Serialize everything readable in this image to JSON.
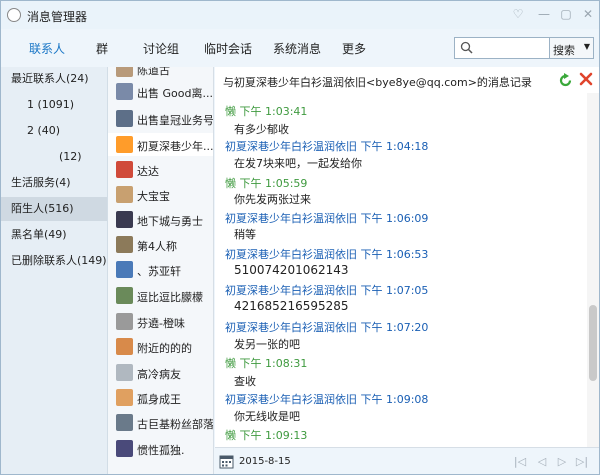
{
  "window": {
    "title": "消息管理器"
  },
  "nav": {
    "tabs": [
      "联系人",
      "群",
      "讨论组",
      "临时会话",
      "系统消息",
      "更多"
    ],
    "search_placeholder": "",
    "search_button": "搜索"
  },
  "left_panel": {
    "items": [
      {
        "label": "最近联系人(24)"
      },
      {
        "label": "1       (1091)"
      },
      {
        "label": "2         (40)"
      },
      {
        "label": "(12)"
      },
      {
        "label": "生活服务(4)"
      },
      {
        "label": "陌生人(516)"
      },
      {
        "label": "黑名单(49)"
      },
      {
        "label": "已删除联系人(149)"
      }
    ]
  },
  "contacts": [
    {
      "name": "陈道古",
      "color": "#b89a7a"
    },
    {
      "name": "出售  Good离...",
      "color": "#7a8aa8"
    },
    {
      "name": "出售皇冠业务号",
      "color": "#5d6f88"
    },
    {
      "name": "初夏深巷少年...",
      "color": "#ff9c2a"
    },
    {
      "name": "达达",
      "color": "#d04a3a"
    },
    {
      "name": "大宝宝",
      "color": "#c8a070"
    },
    {
      "name": "地下城与勇士",
      "color": "#3a3a50"
    },
    {
      "name": "第4人称",
      "color": "#8c7a5a"
    },
    {
      "name": "、苏亚轩",
      "color": "#4a7ab8"
    },
    {
      "name": "逗比逗比朦檬",
      "color": "#6a8a5a"
    },
    {
      "name": "芬遶-橙味",
      "color": "#9a9a9a"
    },
    {
      "name": "附近的的的",
      "color": "#d88a4a"
    },
    {
      "name": "高冷病友",
      "color": "#b0b8c0"
    },
    {
      "name": "孤身成王",
      "color": "#e0a060"
    },
    {
      "name": "古巨基粉丝部落",
      "color": "#6a7a8a"
    },
    {
      "name": "惯性孤独.",
      "color": "#4a4a7a"
    }
  ],
  "chat": {
    "title": "与初夏深巷少年白衫温润依旧<bye8ye@qq.com>的消息记录",
    "colors": {
      "me": "#3f9a3f",
      "other": "#1a5fb4"
    },
    "messages": [
      {
        "who": "me",
        "header": "懒 下午 1:03:41",
        "body": "有多少郁收"
      },
      {
        "who": "other",
        "header": "初夏深巷少年白衫温润依旧 下午 1:04:18",
        "body": "在发7块来吧，一起发给你"
      },
      {
        "who": "me",
        "header": "懒 下午 1:05:59",
        "body": "你先发两张过来"
      },
      {
        "who": "other",
        "header": "初夏深巷少年白衫温润依旧 下午 1:06:09",
        "body": "稍等"
      },
      {
        "who": "other",
        "header": "初夏深巷少年白衫温润依旧 下午 1:06:53",
        "body": "510074201062143"
      },
      {
        "who": "other",
        "header": "初夏深巷少年白衫温润依旧 下午 1:07:05",
        "body": "421685216595285"
      },
      {
        "who": "other",
        "header": "初夏深巷少年白衫温润依旧 下午 1:07:20",
        "body": "发另一张的吧"
      },
      {
        "who": "me",
        "header": "懒 下午 1:08:31",
        "body": "查收"
      },
      {
        "who": "other",
        "header": "初夏深巷少年白衫温润依旧 下午 1:09:08",
        "body": "你无线收是吧"
      },
      {
        "who": "me",
        "header": "懒 下午 1:09:13",
        "body": ""
      }
    ]
  },
  "footer": {
    "date": "2015-8-15"
  }
}
